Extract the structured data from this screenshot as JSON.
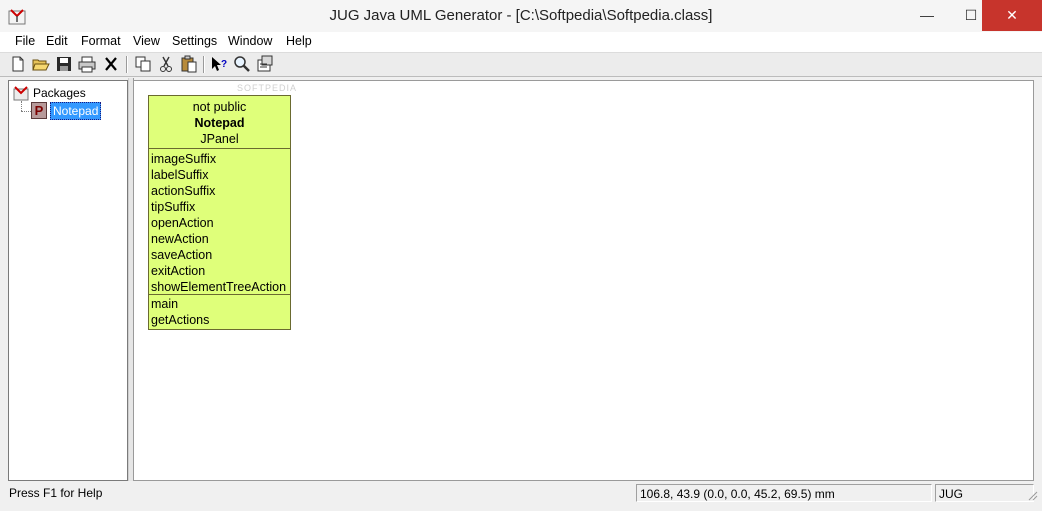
{
  "window": {
    "title": "JUG Java UML Generator - [C:\\Softpedia\\Softpedia.class]",
    "minimize": "—",
    "maximize": "☐",
    "close": "✕"
  },
  "menu": [
    "File",
    "Edit",
    "Format",
    "View",
    "Settings",
    "Window",
    "Help"
  ],
  "toolbar": {
    "icons": [
      "new-file-icon",
      "open-folder-icon",
      "save-icon",
      "print-icon",
      "delete-icon",
      "copy-icon",
      "cut-icon",
      "paste-icon",
      "context-help-icon",
      "zoom-icon",
      "properties-icon"
    ]
  },
  "tree": {
    "root_label": "Packages",
    "child_label": "Notepad",
    "child_icon_letter": "P"
  },
  "canvas": {
    "watermark": "SOFTPEDIA"
  },
  "uml": {
    "modifier": "not public",
    "class_name": "Notepad",
    "superclass": "JPanel",
    "fields": [
      "imageSuffix",
      "labelSuffix",
      "actionSuffix",
      "tipSuffix",
      "openAction",
      "newAction",
      "saveAction",
      "exitAction",
      "showElementTreeAction"
    ],
    "methods": [
      "main",
      "getActions"
    ],
    "fill_color": "#dfff7a"
  },
  "status": {
    "help": "Press F1 for Help",
    "coords": "106.8, 43.9 (0.0, 0.0, 45.2, 69.5) mm",
    "mode": "JUG"
  }
}
